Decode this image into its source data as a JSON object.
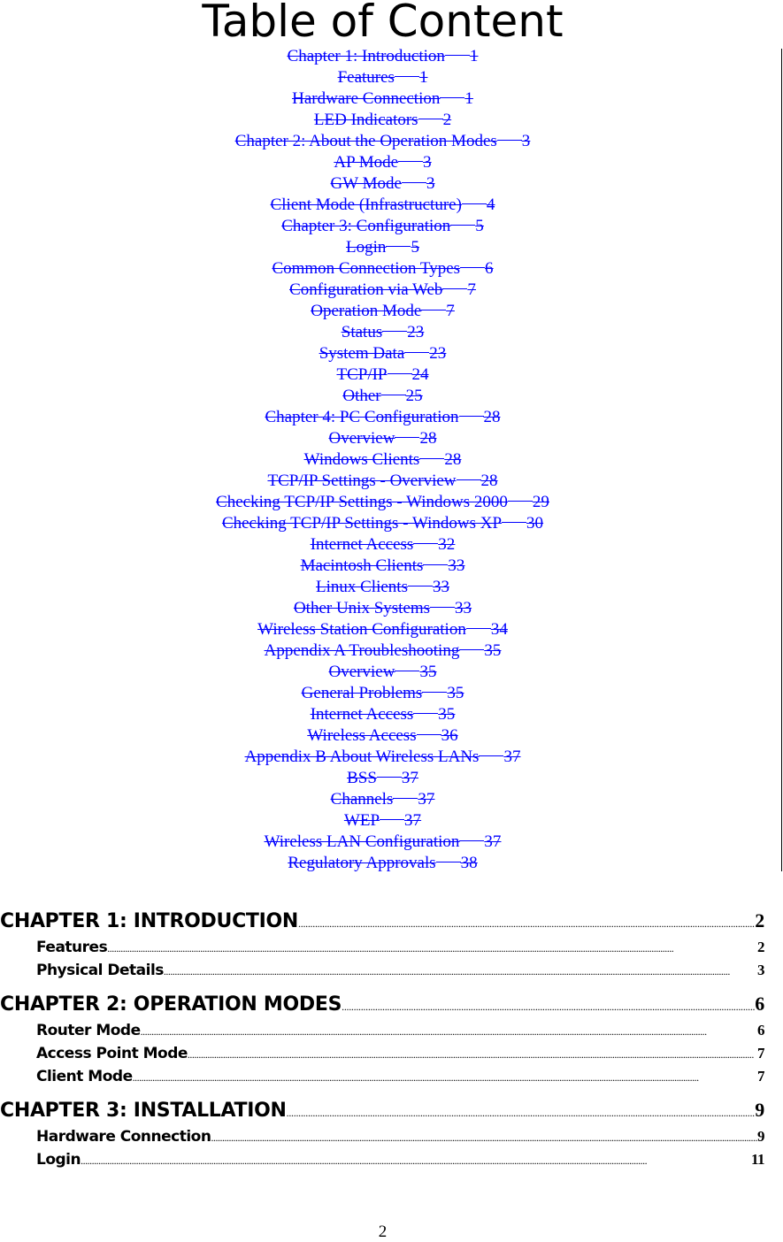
{
  "title": "Table of Content",
  "old_toc": [
    {
      "label": "Chapter 1: Introduction",
      "page": "1"
    },
    {
      "label": "Features",
      "page": "1"
    },
    {
      "label": "Hardware Connection",
      "page": "1"
    },
    {
      "label": "LED Indicators",
      "page": "2"
    },
    {
      "label": "Chapter 2: About the Operation Modes",
      "page": "3"
    },
    {
      "label": "AP Mode",
      "page": "3"
    },
    {
      "label": "GW Mode",
      "page": "3"
    },
    {
      "label": "Client Mode (Infrastructure)",
      "page": "4"
    },
    {
      "label": "Chapter 3: Configuration",
      "page": "5"
    },
    {
      "label": "Login",
      "page": "5"
    },
    {
      "label": "Common Connection Types",
      "page": "6"
    },
    {
      "label": "Configuration via Web",
      "page": "7"
    },
    {
      "label": "Operation Mode",
      "page": "7"
    },
    {
      "label": "Status",
      "page": "23"
    },
    {
      "label": "System Data",
      "page": "23"
    },
    {
      "label": "TCP/IP",
      "page": "24"
    },
    {
      "label": "Other",
      "page": "25"
    },
    {
      "label": "Chapter 4: PC Configuration",
      "page": "28"
    },
    {
      "label": "Overview",
      "page": "28"
    },
    {
      "label": "Windows Clients",
      "page": "28"
    },
    {
      "label": "TCP/IP Settings - Overview",
      "page": "28"
    },
    {
      "label": "Checking TCP/IP Settings - Windows 2000",
      "page": "29"
    },
    {
      "label": "Checking TCP/IP Settings - Windows XP",
      "page": "30"
    },
    {
      "label": "Internet Access",
      "page": "32"
    },
    {
      "label": "Macintosh Clients",
      "page": "33"
    },
    {
      "label": "Linux Clients",
      "page": "33"
    },
    {
      "label": "Other Unix Systems",
      "page": "33"
    },
    {
      "label": "Wireless Station Configuration",
      "page": "34"
    },
    {
      "label": "Appendix A Troubleshooting",
      "page": "35"
    },
    {
      "label": "Overview",
      "page": "35"
    },
    {
      "label": "General Problems",
      "page": "35"
    },
    {
      "label": "Internet Access",
      "page": "35"
    },
    {
      "label": "Wireless Access",
      "page": "36"
    },
    {
      "label": "Appendix B About Wireless LANs",
      "page": "37"
    },
    {
      "label": "BSS",
      "page": "37"
    },
    {
      "label": "Channels",
      "page": "37"
    },
    {
      "label": "WEP",
      "page": "37"
    },
    {
      "label": "Wireless LAN Configuration",
      "page": "37"
    },
    {
      "label": "Regulatory Approvals",
      "page": "38"
    }
  ],
  "new_toc": [
    {
      "level": "ch",
      "label": "CHAPTER 1: INTRODUCTION",
      "page": "2"
    },
    {
      "level": "sub",
      "label": "Features",
      "page": "2"
    },
    {
      "level": "sub",
      "label": "Physical Details",
      "page": "3"
    },
    {
      "level": "ch",
      "label": "CHAPTER 2: OPERATION MODES",
      "page": "6"
    },
    {
      "level": "sub",
      "label": "Router Mode",
      "page": "6"
    },
    {
      "level": "sub",
      "label": "Access Point Mode",
      "page": "7"
    },
    {
      "level": "sub",
      "label": "Client Mode",
      "page": "7"
    },
    {
      "level": "ch",
      "label": "CHAPTER 3: INSTALLATION",
      "page": "9"
    },
    {
      "level": "sub",
      "label": "Hardware Connection",
      "page": "9"
    },
    {
      "level": "sub",
      "label": "Login",
      "page": "11"
    }
  ],
  "page_number": "2",
  "colors": {
    "link": "#0000ff",
    "text": "#000000"
  }
}
